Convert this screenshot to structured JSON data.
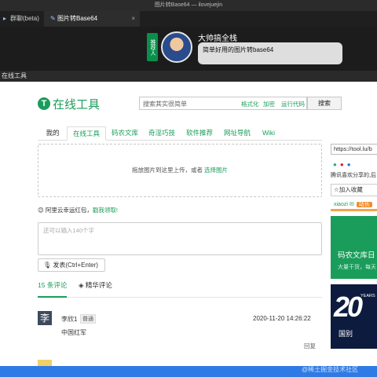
{
  "window": {
    "title": "图片转Base64 — ilovejuejin"
  },
  "tabs": [
    {
      "label": "群聊(beta)"
    },
    {
      "label": "图片转Base64"
    }
  ],
  "promo": {
    "badge": "推荐人",
    "name": "大帅搞全栈",
    "message": "简单好用的图片转base64"
  },
  "bookmarks": {
    "label": "在线工具"
  },
  "site": {
    "logo_text": "在线工具",
    "search_placeholder": "搜索其实很简单",
    "search_links": [
      "格式化",
      "加密",
      "运行代码"
    ],
    "search_button": "搜索"
  },
  "nav": [
    {
      "label": "我的"
    },
    {
      "label": "在线工具"
    },
    {
      "label": "码农文库"
    },
    {
      "label": "奇淫巧技"
    },
    {
      "label": "软件推荐"
    },
    {
      "label": "网址导航"
    },
    {
      "label": "Wiki"
    }
  ],
  "upload": {
    "hint": "拖放图片到这里上传，或者 ",
    "pick": "选择图片"
  },
  "redpack": {
    "text": "阿里云幸运红包，",
    "link": "戳我领取!"
  },
  "comment": {
    "placeholder": "还可以输入140个字",
    "post_button": "发表(Ctrl+Enter)",
    "tab_count": "15 条评论",
    "tab_best": "精华评论"
  },
  "comments": [
    {
      "avatar_char": "李",
      "user": "李欣1",
      "tag": "普通",
      "time": "2020-11-20 14:26:22",
      "text": "中国红军",
      "reply": "回复"
    }
  ],
  "sidebar": {
    "url": "https://tool.lu/b",
    "share_note": "腾讯喜欢分享的,后",
    "favorite": "加入收藏",
    "user": "xiaozi",
    "user_tag": "站长",
    "ad1_title": "码农文库日",
    "ad1_sub": "大量干货，每天",
    "ad2_big": "20",
    "ad2_years": "YEARS",
    "ad2_text": "国别"
  },
  "watermark": "@稀土掘金技术社区",
  "colors": {
    "brand": "#1a9d5a",
    "dark": "#1c1c1c",
    "accent": "#2f7be5"
  }
}
